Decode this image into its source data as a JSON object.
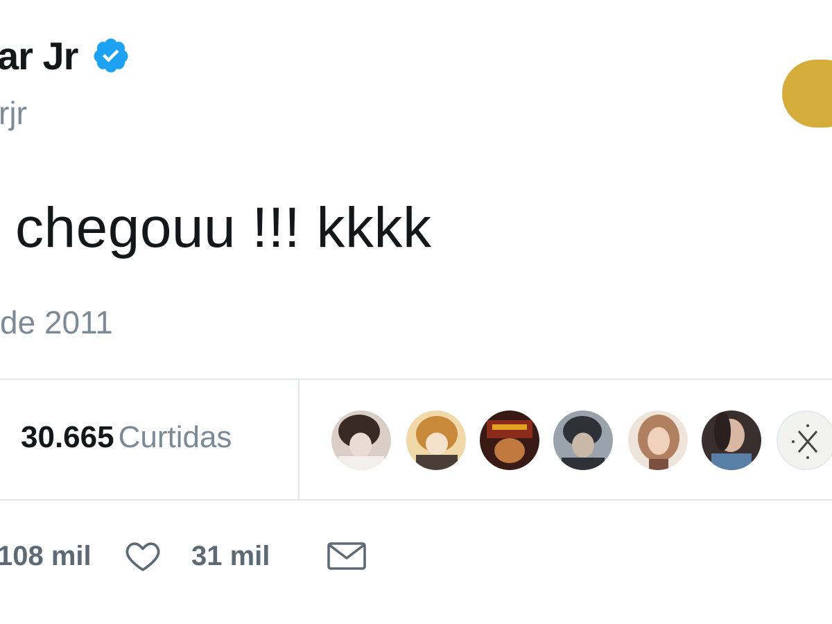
{
  "tweet": {
    "author_name": "ar Jr",
    "author_handle": "rjr",
    "text": "chegouu !!! kkkk",
    "date": "de 2011"
  },
  "stats": {
    "likes_count": "30.665",
    "likes_label": "Curtidas"
  },
  "likers": [
    {
      "name": "liker-avatar-1",
      "colors": [
        "#3a2a25",
        "#e9dcd2"
      ]
    },
    {
      "name": "liker-avatar-2",
      "colors": [
        "#c8893a",
        "#4a3f38"
      ]
    },
    {
      "name": "liker-avatar-3",
      "colors": [
        "#8a2a1a",
        "#e0a020"
      ]
    },
    {
      "name": "liker-avatar-4",
      "colors": [
        "#2e3238",
        "#9aa3ab"
      ]
    },
    {
      "name": "liker-avatar-5",
      "colors": [
        "#d9b9a0",
        "#7a5040"
      ]
    },
    {
      "name": "liker-avatar-6",
      "colors": [
        "#3a2f2f",
        "#5a7fa6"
      ]
    },
    {
      "name": "liker-avatar-7",
      "colors": [
        "#f2f2ee",
        "#444444"
      ]
    }
  ],
  "actions": {
    "retweet_count": "108 mil",
    "like_count": "31 mil"
  },
  "colors": {
    "verified": "#1da1f2",
    "follow_accent": "#d4ad3a",
    "muted_text": "#7b8a96",
    "action_gray": "#5d6a75"
  },
  "icons": {
    "verified": "verified-badge-icon",
    "like": "heart-icon",
    "dm": "envelope-icon"
  }
}
